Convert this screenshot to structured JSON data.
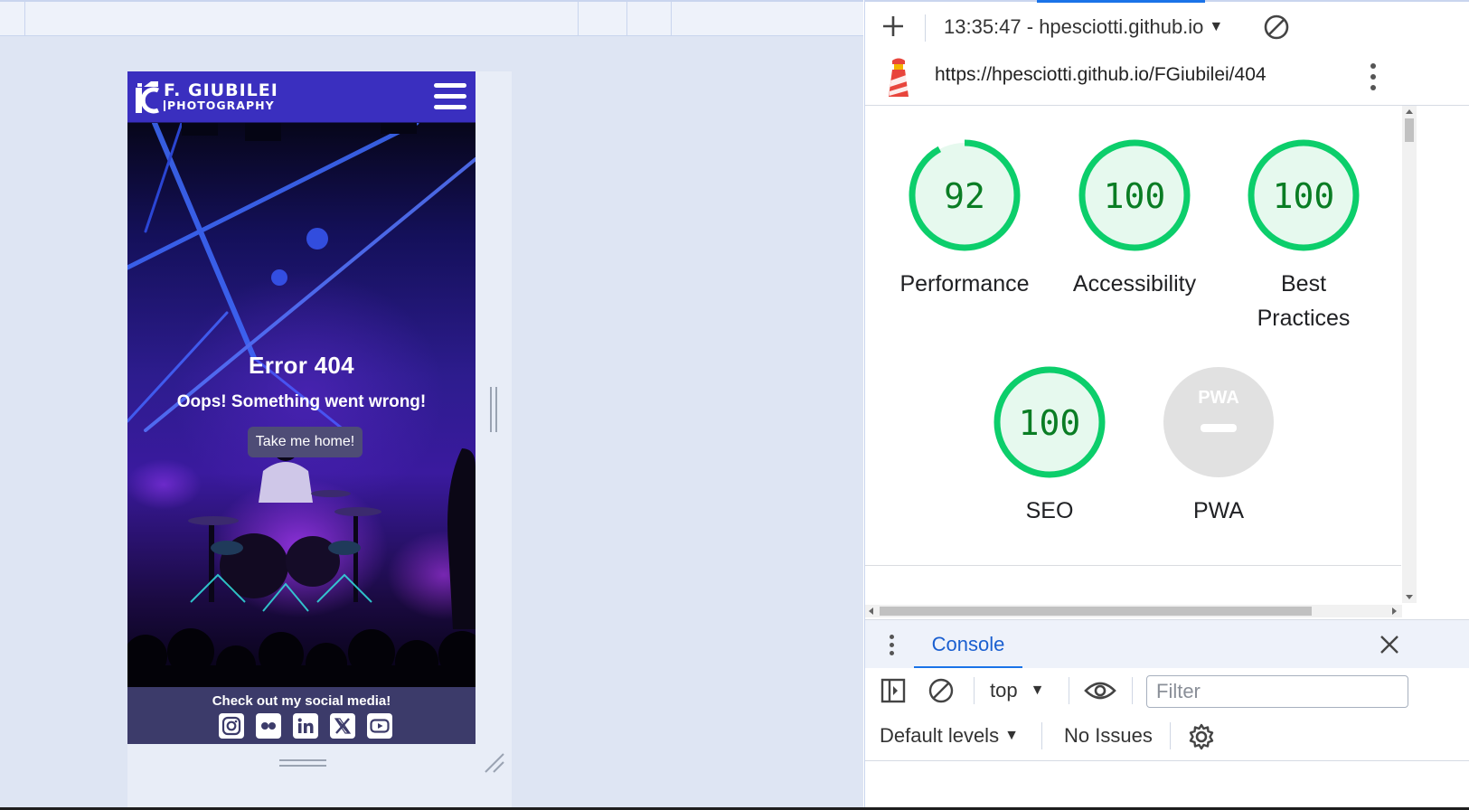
{
  "device_preview": {
    "site": {
      "logo_line1": "F. GIUBILEI",
      "logo_line2": "PHOTOGRAPHY",
      "error_title": "Error 404",
      "error_subtitle": "Oops! Something went wrong!",
      "home_button": "Take me home!",
      "footer_label": "Check out my social media!",
      "social_icons": [
        "instagram-icon",
        "flickr-icon",
        "linkedin-icon",
        "x-icon",
        "youtube-icon"
      ]
    }
  },
  "devtools": {
    "report_selector": "13:35:47 - hpesciotti.github.io",
    "report_url": "https://hpesciotti.github.io/FGiubilei/404",
    "scores": [
      {
        "label": "Performance",
        "value": "92",
        "score": 92
      },
      {
        "label": "Accessibility",
        "value": "100",
        "score": 100
      },
      {
        "label": "Best Practices",
        "value": "100",
        "score": 100
      },
      {
        "label": "SEO",
        "value": "100",
        "score": 100
      },
      {
        "label": "PWA",
        "value": "PWA",
        "score": null
      }
    ],
    "drawer": {
      "tab": "Console",
      "context": "top",
      "filter_placeholder": "Filter",
      "levels": "Default levels",
      "issues": "No Issues"
    }
  },
  "colors": {
    "accent_blue": "#1a73e8",
    "score_green": "#0cce6b",
    "score_text": "#0a7d24",
    "site_header": "#3a2fbf",
    "site_footer": "#3c3b6a"
  }
}
